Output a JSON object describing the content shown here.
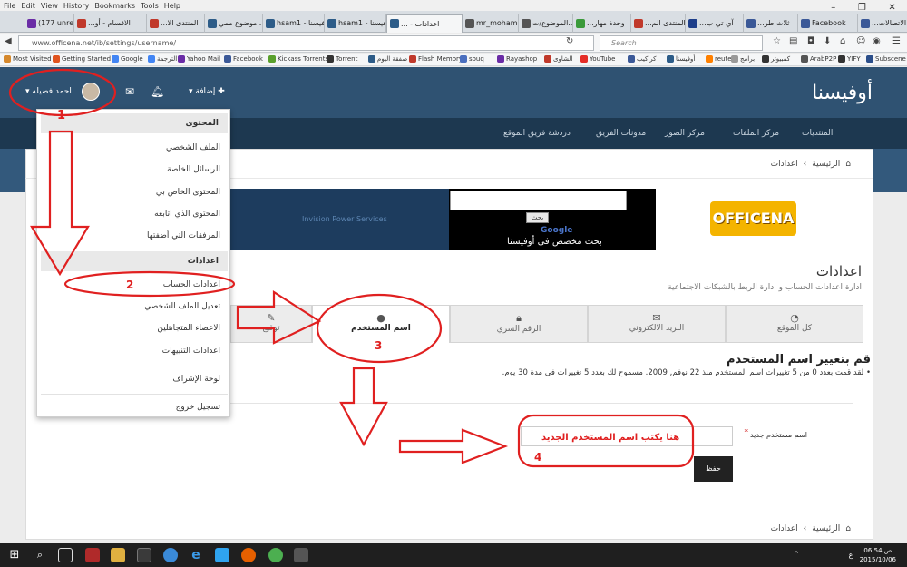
{
  "browser": {
    "menu": [
      "File",
      "Edit",
      "View",
      "History",
      "Bookmarks",
      "Tools",
      "Help"
    ],
    "tabs": [
      {
        "label": "(177 unre...",
        "color": "#6a2ca6"
      },
      {
        "label": "...الاقسام - أو",
        "color": "#c0392b"
      },
      {
        "label": "...المنتدى الا",
        "color": "#c0392b"
      },
      {
        "label": "موضوع ممي...",
        "color": "#2d5c88"
      },
      {
        "label": "hsam1 - أوفيسنا",
        "color": "#2d5c88"
      },
      {
        "label": "hsam1 - أوفيسنا",
        "color": "#2d5c88"
      },
      {
        "label": "... - اعدادات",
        "color": "#2d5c88"
      },
      {
        "label": "mr_mohame...",
        "color": "#555555"
      },
      {
        "label": "الموضوع/ت...",
        "color": "#555555"
      },
      {
        "label": "...وحدة مهار",
        "color": "#3a9a3a"
      },
      {
        "label": "...المنتدى الم",
        "color": "#c0392b"
      },
      {
        "label": "...آي تي ب",
        "color": "#1d3e8a"
      },
      {
        "label": "...ثلاث طر",
        "color": "#3b5998"
      },
      {
        "label": "Facebook",
        "color": "#3b5998"
      },
      {
        "label": "...الاتصالات",
        "color": "#3b5998"
      }
    ],
    "url": "www.officena.net/ib/settings/username/",
    "search_placeholder": "Search",
    "bookmarks": [
      "Most Visited",
      "Getting Started",
      "Google",
      "الترجمة",
      "Yahoo Mail",
      "Facebook",
      "Kickass Torrents",
      "Torrent",
      "صفقة اليوم",
      "Flash Memory",
      "souq",
      "Rayashop",
      "الشاوى",
      "YouTube",
      "كراكيب",
      "أوفيسنا",
      "reuters",
      "برامج",
      "كمبيوتر",
      "ArabP2P",
      "YIFY",
      "Subscene"
    ]
  },
  "site": {
    "logo": "أوفيسنا",
    "nav": [
      "المنتديات",
      "مركز الملفات",
      "مركز الصور",
      "مدونات الفريق",
      "دردشة فريق الموقع"
    ],
    "breadcrumb": {
      "home": "الرئيسية",
      "current": "اعدادات"
    },
    "banner": {
      "ipb": "Invision Power Services",
      "search_button": "بحث",
      "google": "Google",
      "tagline": "بحث مخصص فى أوفيسنا",
      "logo": "OFFICENA"
    }
  },
  "userbar": {
    "add_label": "إضافة",
    "username": "احمد فضيله"
  },
  "dropdown": {
    "content_header": "المحتوى",
    "content_items": [
      "الملف الشخصي",
      "الرسائل الخاصة",
      "المحتوى الخاص بي",
      "المحتوى الذي اتابعه",
      "المرفقات التي أضفتها"
    ],
    "settings_header": "اعدادات",
    "settings_items": [
      "اعدادات الحساب",
      "تعديل الملف الشخصي",
      "الاعضاء المتجاهلين",
      "اعدادات التنبيهات"
    ],
    "admin": "لوحة الإشراف",
    "logout": "تسجيل خروج"
  },
  "page": {
    "title": "اعدادات",
    "subtitle": "ادارة اعدادات الحساب و ادارة الربط بالشبكات الاجتماعية",
    "tabs": [
      "كل الموقع",
      "البريد الالكتروني",
      "الرقم السري",
      "اسم المستخدم",
      "توقيع"
    ],
    "form_title": "قم بتغيير اسم المستخدم",
    "form_note": "لقد قمت بعدد 0 من 5 تغييرات اسم المستخدم منذ 22 نوفم, 2009. مسموح لك بعدد 5 تغييرات فى مدة 30 يوم.",
    "field_label": "اسم مستخدم جديد",
    "required_mark": "*",
    "save_label": "حفظ"
  },
  "annotations": {
    "n1": "1",
    "n2": "2",
    "n3": "3",
    "n4": "4",
    "hint": "هنا يكتب اسم المستخدم الجديد",
    "color": "#e02020"
  },
  "taskbar": {
    "time": "06:54 ص",
    "date": "2015/10/06",
    "lang": "ع"
  }
}
